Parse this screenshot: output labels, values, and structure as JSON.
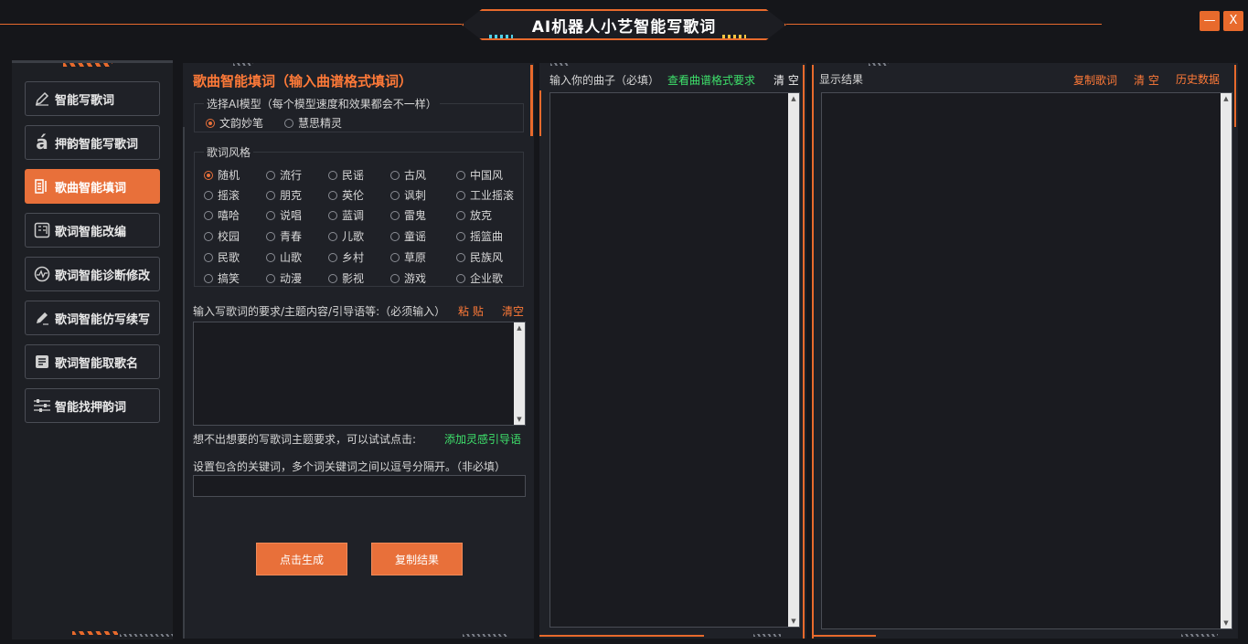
{
  "window": {
    "title": "AI机器人小艺智能写歌词",
    "minimize_label": "—",
    "close_label": "X"
  },
  "sidebar": {
    "items": [
      {
        "label": "智能写歌词",
        "icon": "pen-icon",
        "active": false
      },
      {
        "label": "押韵智能写歌词",
        "icon": "accent-a-icon",
        "active": false
      },
      {
        "label": "歌曲智能填词",
        "icon": "list-icon",
        "active": true
      },
      {
        "label": "歌词智能改编",
        "icon": "ci-icon",
        "active": false
      },
      {
        "label": "歌词智能诊断修改",
        "icon": "pulse-icon",
        "active": false
      },
      {
        "label": "歌词智能仿写续写",
        "icon": "pen-edit-icon",
        "active": false
      },
      {
        "label": "歌词智能取歌名",
        "icon": "document-icon",
        "active": false
      },
      {
        "label": "智能找押韵词",
        "icon": "sliders-icon",
        "active": false
      }
    ]
  },
  "fill_panel": {
    "title": "歌曲智能填词（输入曲谱格式填词）",
    "model_group_label": "选择AI模型（每个模型速度和效果都会不一样）",
    "models": [
      {
        "label": "文韵妙笔",
        "selected": true
      },
      {
        "label": "慧思精灵",
        "selected": false
      }
    ],
    "style_group_label": "歌词风格",
    "styles": [
      [
        "随机",
        "流行",
        "民谣",
        "古风",
        "中国风"
      ],
      [
        "摇滚",
        "朋克",
        "英伦",
        "讽刺",
        "工业摇滚"
      ],
      [
        "嘻哈",
        "说唱",
        "蓝调",
        "雷鬼",
        "放克"
      ],
      [
        "校园",
        "青春",
        "儿歌",
        "童谣",
        "摇篮曲"
      ],
      [
        "民歌",
        "山歌",
        "乡村",
        "草原",
        "民族风"
      ],
      [
        "搞笑",
        "动漫",
        "影视",
        "游戏",
        "企业歌"
      ]
    ],
    "selected_style": "随机",
    "requirement_label": "输入写歌词的要求/主题内容/引导语等:（必须输入）",
    "paste_label": "粘 贴",
    "clear_label": "清空",
    "requirement_value": "",
    "hint_text": "想不出想要的写歌词主题要求，可以试试点击:",
    "inspire_link": "添加灵感引导语",
    "keywords_label": "设置包含的关键词，多个词关键词之间以逗号分隔开。（非必填）",
    "keywords_value": "",
    "generate_button": "点击生成",
    "copy_result_button": "复制结果"
  },
  "tune_panel": {
    "label": "输入你的曲子（必填）",
    "format_link": "查看曲谱格式要求",
    "clear_label": "清 空",
    "value": ""
  },
  "result_panel": {
    "label": "显示结果",
    "copy_lyrics": "复制歌词",
    "clear_label": "清 空",
    "history_label": "历史数据",
    "value": ""
  },
  "colors": {
    "accent": "#e8703a",
    "green_link": "#3ee06b",
    "background": "#15161a",
    "panel": "#1f2127"
  }
}
